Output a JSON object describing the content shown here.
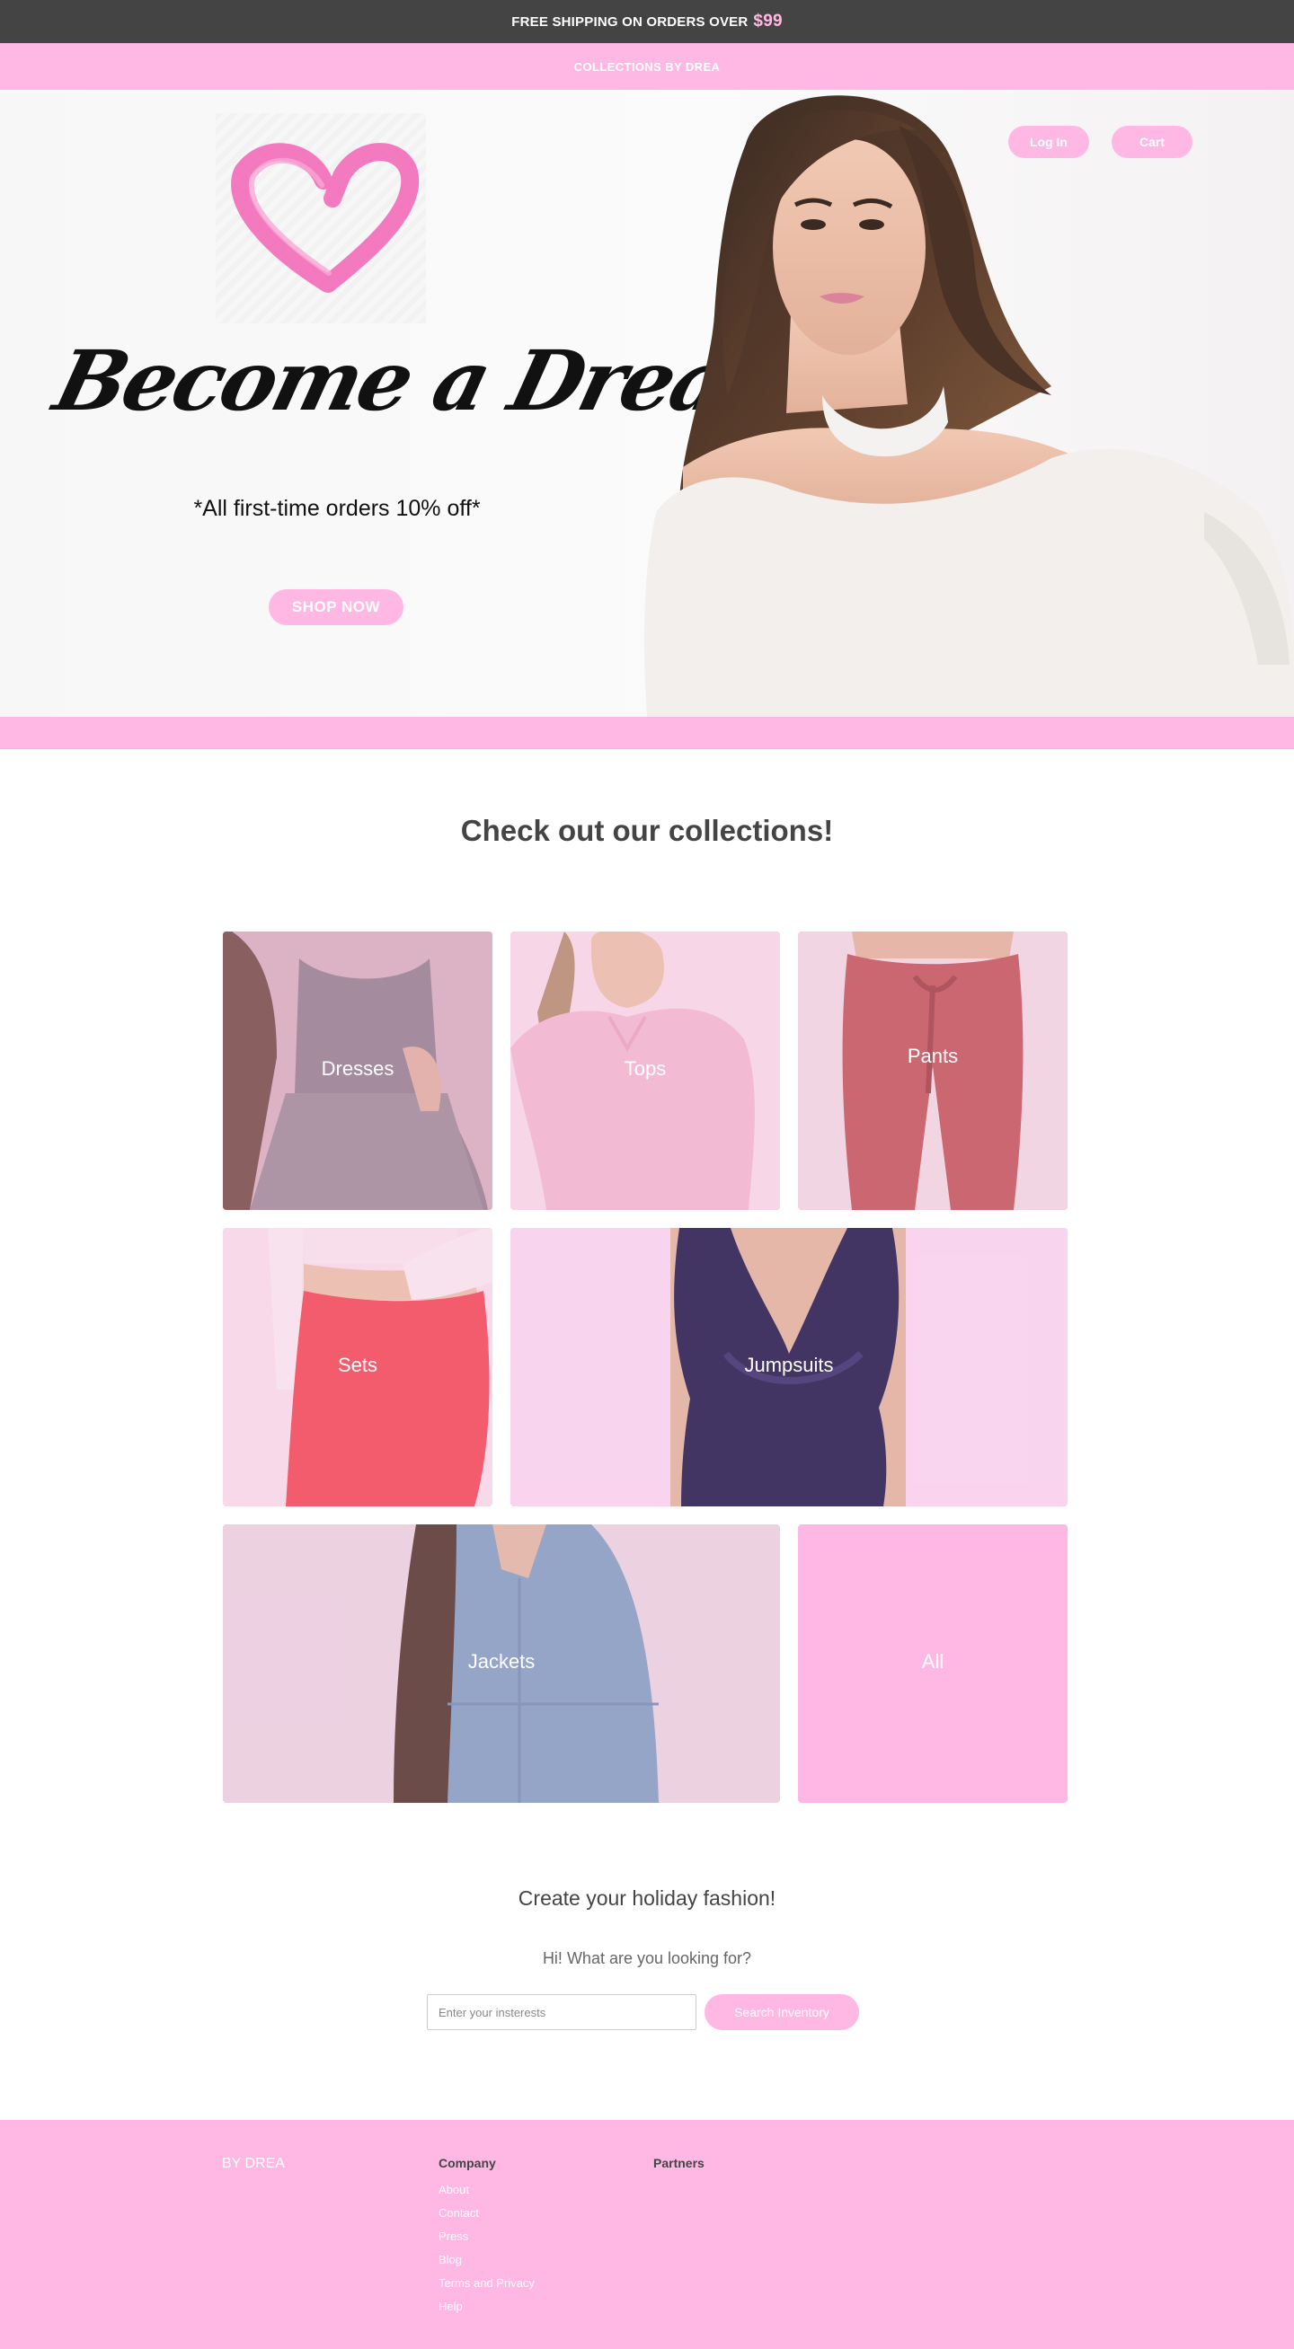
{
  "topbar": {
    "text": "FREE SHIPPING ON ORDERS OVER",
    "price": "$99"
  },
  "brandbar": {
    "text": "COLLECTIONS BY DREA"
  },
  "header": {
    "login_label": "Log In",
    "cart_label": "Cart"
  },
  "hero": {
    "title": "Become a Drea Doll",
    "subtitle": "*All first-time orders 10% off*",
    "cta_label": "SHOP NOW"
  },
  "collections": {
    "title": "Check out our collections!",
    "items": [
      {
        "label": "Dresses"
      },
      {
        "label": "Tops"
      },
      {
        "label": "Pants"
      },
      {
        "label": "Sets"
      },
      {
        "label": "Jumpsuits"
      },
      {
        "label": "Jackets"
      },
      {
        "label": "All"
      }
    ]
  },
  "search": {
    "heading": "Create your holiday fashion!",
    "prompt": "Hi! What are you looking for?",
    "placeholder": "Enter your insterests",
    "button_label": "Search Inventory"
  },
  "footer": {
    "brand": "BY DREA",
    "company_heading": "Company",
    "company_links": [
      "About",
      "Contact",
      "Press",
      "Blog",
      "Terms and Privacy",
      "Help"
    ],
    "partners_heading": "Partners"
  },
  "colors": {
    "accent_pink": "#ffb8e4",
    "dark_bar": "#444444",
    "text_dark": "#444444"
  },
  "icons": [
    "heart-icon"
  ]
}
